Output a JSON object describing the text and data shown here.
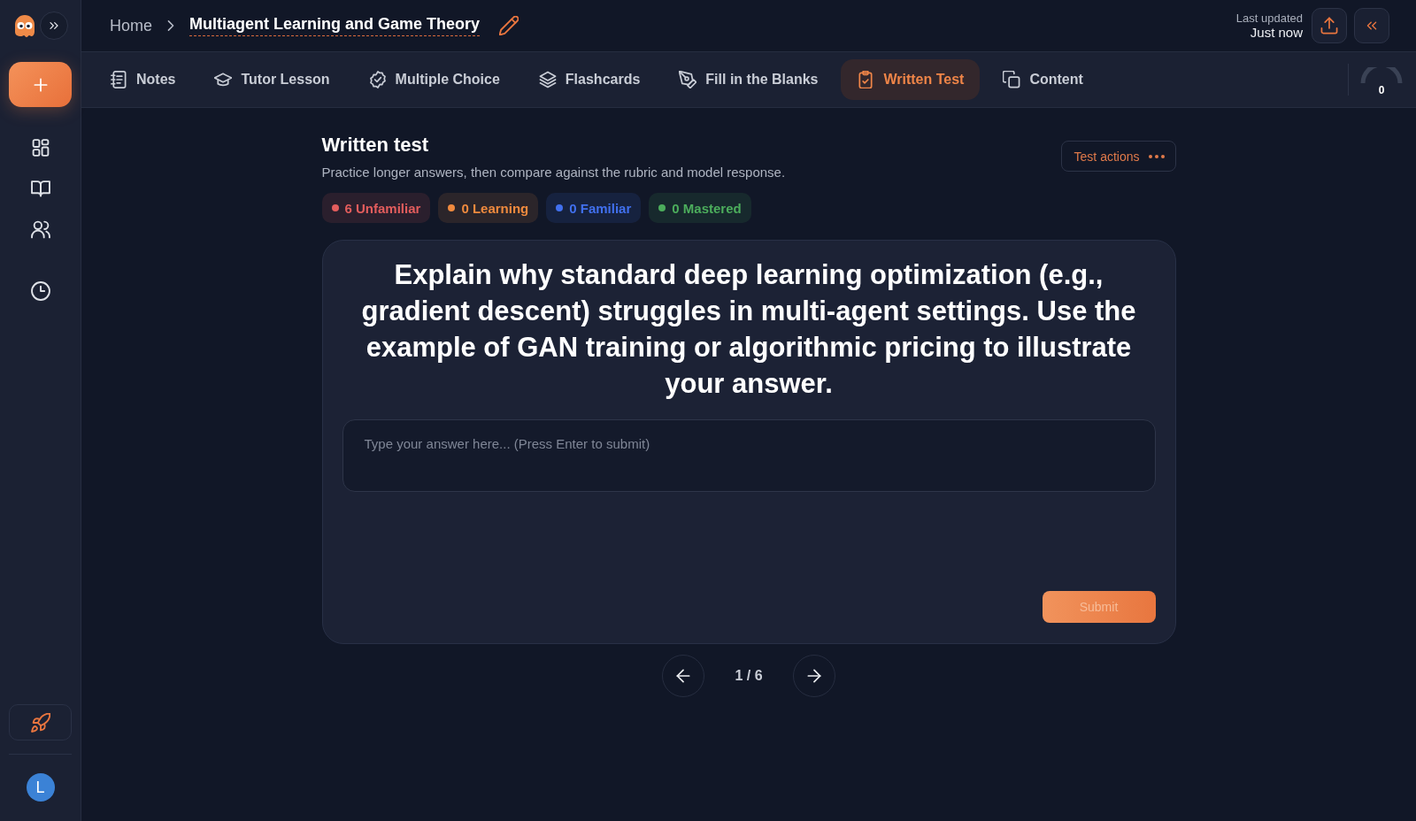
{
  "breadcrumb": {
    "home": "Home",
    "title": "Multiagent Learning and Game Theory"
  },
  "last_updated": {
    "label": "Last updated",
    "time": "Just now"
  },
  "tabs": [
    {
      "label": "Notes",
      "selected": false
    },
    {
      "label": "Tutor Lesson",
      "selected": false
    },
    {
      "label": "Multiple Choice",
      "selected": false
    },
    {
      "label": "Flashcards",
      "selected": false
    },
    {
      "label": "Fill in the Blanks",
      "selected": false
    },
    {
      "label": "Written Test",
      "selected": true
    },
    {
      "label": "Content",
      "selected": false
    }
  ],
  "score": {
    "value": "0"
  },
  "test": {
    "title": "Written test",
    "subtitle": "Practice longer answers, then compare against the rubric and model response.",
    "actions_label": "Test actions",
    "status_badges": [
      {
        "label": "6 Unfamiliar",
        "color": "#e35d5d"
      },
      {
        "label": "0 Learning",
        "color": "#ef8a3e"
      },
      {
        "label": "0 Familiar",
        "color": "#4170ee"
      },
      {
        "label": "0 Mastered",
        "color": "#4cad5c"
      }
    ],
    "question": "Explain why standard deep learning optimization (e.g., gradient descent) struggles in multi-agent settings. Use the example of GAN training or algorithmic pricing to illustrate your answer.",
    "answer": {
      "placeholder": "Type your answer here... (Press Enter to submit)"
    },
    "submit": {
      "label": "Submit",
      "disabled": true
    }
  },
  "pagination": {
    "label": "1 / 6"
  },
  "user": {
    "initial": "L"
  }
}
